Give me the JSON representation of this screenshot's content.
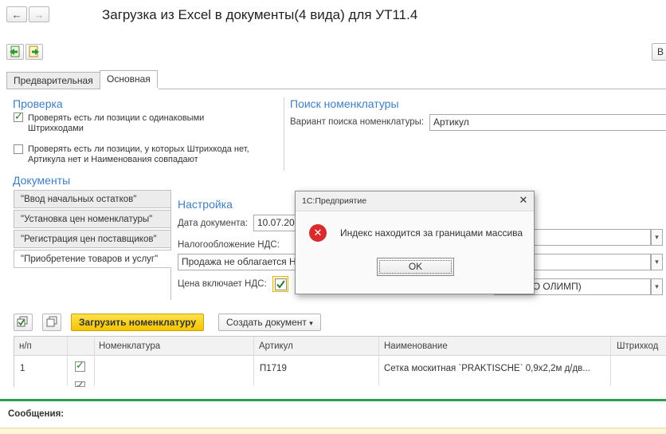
{
  "window": {
    "title": "Загрузка из Excel в документы(4 вида) для УТ11.4",
    "back_glyph": "←",
    "forward_glyph": "→",
    "right_edge_button": "В"
  },
  "tabs": [
    {
      "label": "Предварительная",
      "active": false
    },
    {
      "label": "Основная",
      "active": true
    }
  ],
  "check_section": {
    "title": "Проверка",
    "items": [
      {
        "label": "Проверять есть ли позиции с одинаковыми Штрихкодами",
        "checked": true
      },
      {
        "label": "Проверять есть ли позиции, у которых Штрихкода нет, Артикула нет и Наименования совпадают",
        "checked": false
      }
    ]
  },
  "search_section": {
    "title": "Поиск номенклатуры",
    "variant_label": "Вариант поиска номенклатуры:",
    "variant_value": "Артикул"
  },
  "documents": {
    "title": "Документы",
    "items": [
      "\"Ввод начальных остатков\"",
      "\"Установка цен номенклатуры\"",
      "\"Регистрация цен поставщиков\"",
      "\"Приобретение товаров и услуг\""
    ],
    "active_index": 3
  },
  "settings": {
    "title": "Настройка",
    "date_label": "Дата документа:",
    "date_value": "10.07.20",
    "vat_label": "Налогообложение НДС:",
    "vat_value": "Продажа не облагается Н",
    "price_vat_label": "Цена включает НДС:",
    "price_vat_checked": true,
    "org_value": "орг (ООО ОЛИМП)"
  },
  "toolbar": {
    "load_button": "Загрузить номенклатуру",
    "create_button": "Создать документ",
    "create_arrow": "▾"
  },
  "table": {
    "headers": [
      "н/п",
      "",
      "Номенклатура",
      "Артикул",
      "Наименование",
      "Штрихкод"
    ],
    "rows": [
      {
        "n": "1",
        "checked": true,
        "nomenclature": "",
        "article": "П1719",
        "name": "Сетка москитная `PRAKTISCHE` 0,9х2,2м д/дв...",
        "barcode": ""
      }
    ]
  },
  "messages": {
    "title": "Сообщения:"
  },
  "dialog": {
    "title": "1С:Предприятие",
    "close_glyph": "✕",
    "message": "Индекс находится за границами массива",
    "ok_label": "OK",
    "error_glyph": "✕"
  },
  "colors": {
    "section_blue": "#3f7fc0",
    "accent_yellow": "#f5c400",
    "green_line": "#2e9e4e",
    "error_red": "#d92b2b",
    "check_green": "#2b7a2b"
  }
}
